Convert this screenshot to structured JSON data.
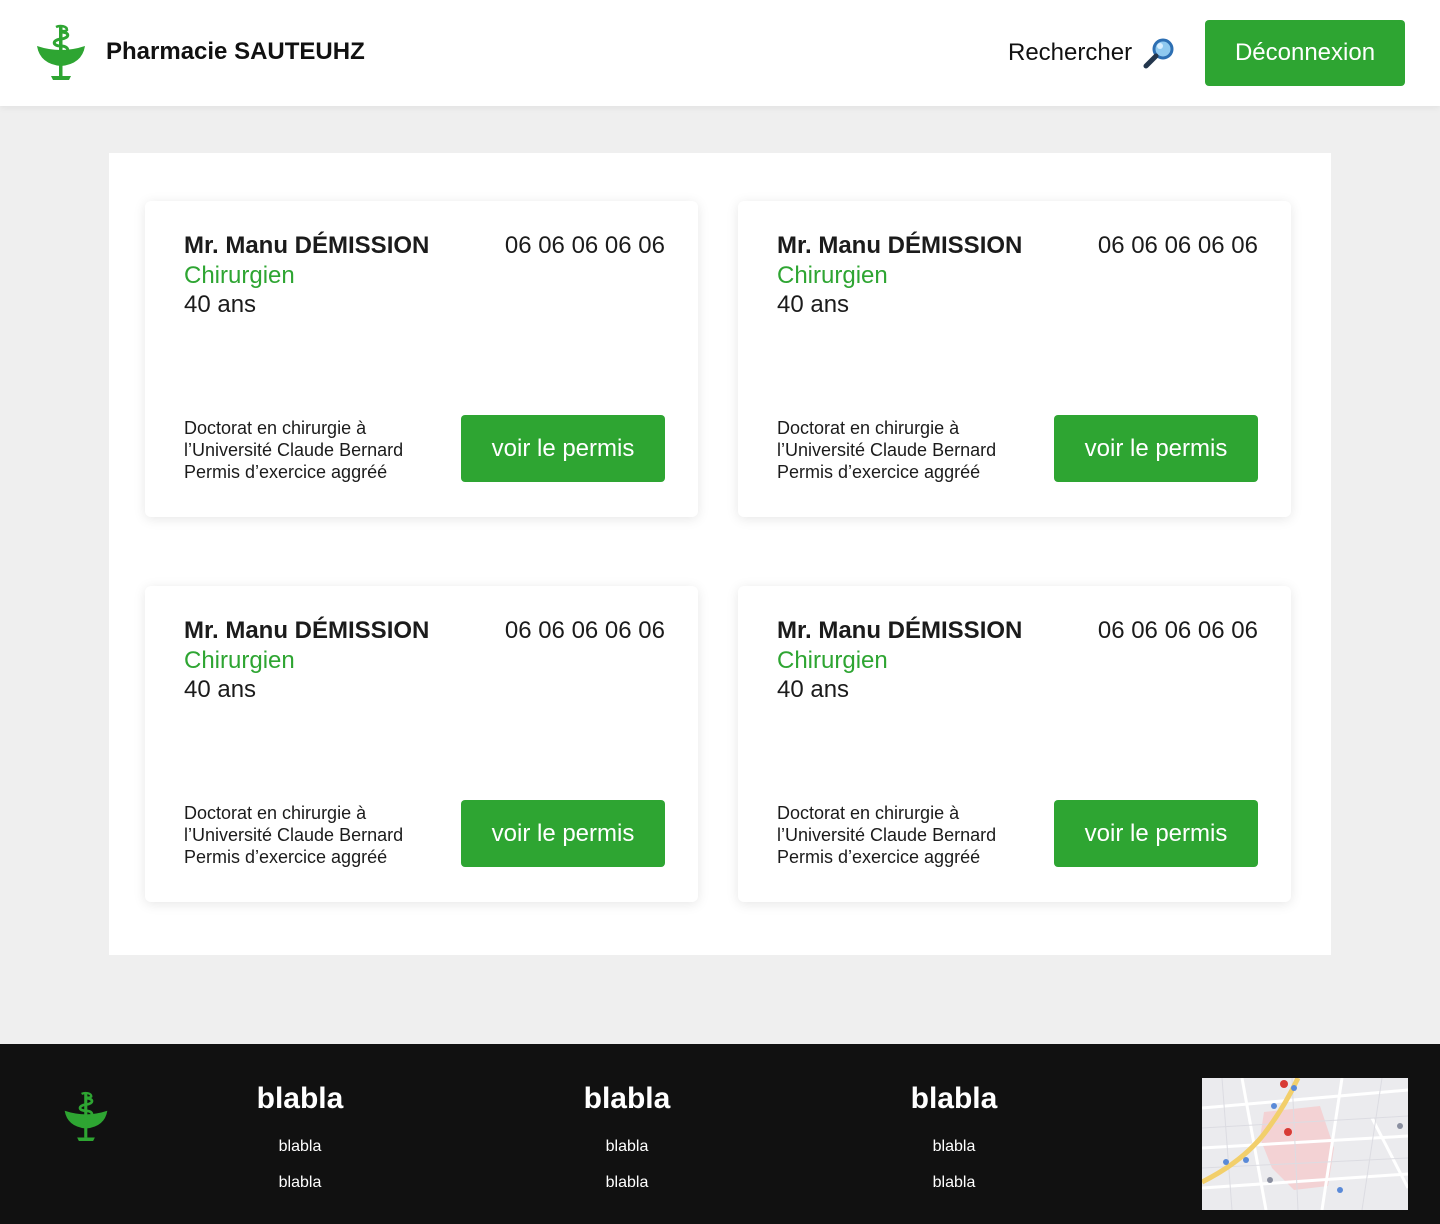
{
  "header": {
    "brand_name": "Pharmacie SAUTEUHZ",
    "search_label": "Rechercher",
    "logout_label": "Déconnexion"
  },
  "cards": [
    {
      "name": "Mr. Manu DÉMISSION",
      "phone": "06 06 06 06 06",
      "role": "Chirurgien",
      "age": "40 ans",
      "desc": [
        "Doctorat en chirurgie à",
        "l’Université Claude Bernard",
        "Permis d’exercice aggréé"
      ],
      "button": "voir le permis"
    },
    {
      "name": "Mr. Manu DÉMISSION",
      "phone": "06 06 06 06 06",
      "role": "Chirurgien",
      "age": "40 ans",
      "desc": [
        "Doctorat en chirurgie à",
        "l’Université Claude Bernard",
        "Permis d’exercice aggréé"
      ],
      "button": "voir le permis"
    },
    {
      "name": "Mr. Manu DÉMISSION",
      "phone": "06 06 06 06 06",
      "role": "Chirurgien",
      "age": "40 ans",
      "desc": [
        "Doctorat en chirurgie à",
        "l’Université Claude Bernard",
        "Permis d’exercice aggréé"
      ],
      "button": "voir le permis"
    },
    {
      "name": "Mr. Manu DÉMISSION",
      "phone": "06 06 06 06 06",
      "role": "Chirurgien",
      "age": "40 ans",
      "desc": [
        "Doctorat en chirurgie à",
        "l’Université Claude Bernard",
        "Permis d’exercice aggréé"
      ],
      "button": "voir le permis"
    }
  ],
  "footer": {
    "columns": [
      {
        "title": "blabla",
        "links": [
          "blabla",
          "blabla"
        ]
      },
      {
        "title": "blabla",
        "links": [
          "blabla",
          "blabla"
        ]
      },
      {
        "title": "blabla",
        "links": [
          "blabla",
          "blabla"
        ]
      }
    ]
  },
  "colors": {
    "accent": "#2ea532",
    "footer_bg": "#111111",
    "page_bg": "#efefef"
  },
  "icons": {
    "brand": "pharmacy-caduceus-icon",
    "search": "magnifying-glass-icon"
  }
}
